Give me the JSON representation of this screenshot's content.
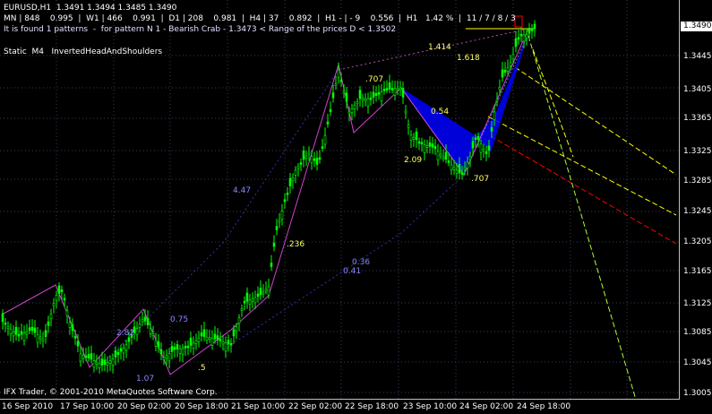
{
  "header": {
    "symbol_line": "EURUSD,H1  1.3491 1.3494 1.3485 1.3490",
    "tf_line": "MN | 848    0.995  |  W1 | 466    0.991  |  D1 | 208    0.981  |  H4 | 37    0.892  |  H1 - | - 9    0.556  |  H1   1.42 %  |  11 / 7 / 8 / 3",
    "pattern_line": "It is found 1 patterns  -  for pattern N 1 - Bearish Crab - 1.3473 < Range of the prices D < 1.3502",
    "static_line": "Static  M4   InvertedHeadAndShoulders"
  },
  "price_scale": {
    "ticks": [
      "1.3445",
      "1.3405",
      "1.3365",
      "1.3325",
      "1.3285",
      "1.3245",
      "1.3205",
      "1.3165",
      "1.3125",
      "1.3085",
      "1.3045",
      "1.3005"
    ],
    "current": "1.3490"
  },
  "time_scale": {
    "ticks": [
      "16 Sep 2010",
      "17 Sep 10:00",
      "20 Sep 02:00",
      "20 Sep 18:00",
      "21 Sep 10:00",
      "22 Sep 02:00",
      "22 Sep 18:00",
      "23 Sep 10:00",
      "24 Sep 02:00",
      "24 Sep 18:00"
    ]
  },
  "ratios": {
    "r1": "1.414",
    "r2": "1.618",
    "r3": ".707",
    "r4": "0.54",
    "r5": "2.09",
    "r6": ".707",
    "r7": "4.47",
    "r8": ".236",
    "r9": "0.36",
    "r10": "0.41",
    "r11": "0.75",
    "r12": "2.82",
    "r13": ".5",
    "r14": "1.07"
  },
  "footer": {
    "copyright": "IFX Trader, © 2001-2010 MetaQuotes Software Corp."
  },
  "colors": {
    "candle": "#00ff00",
    "zigzag": "#cc44cc",
    "pattern": "#0000ff",
    "yellow": "#ffff00",
    "red": "#ff0000",
    "grid": "#3a3a5a"
  }
}
